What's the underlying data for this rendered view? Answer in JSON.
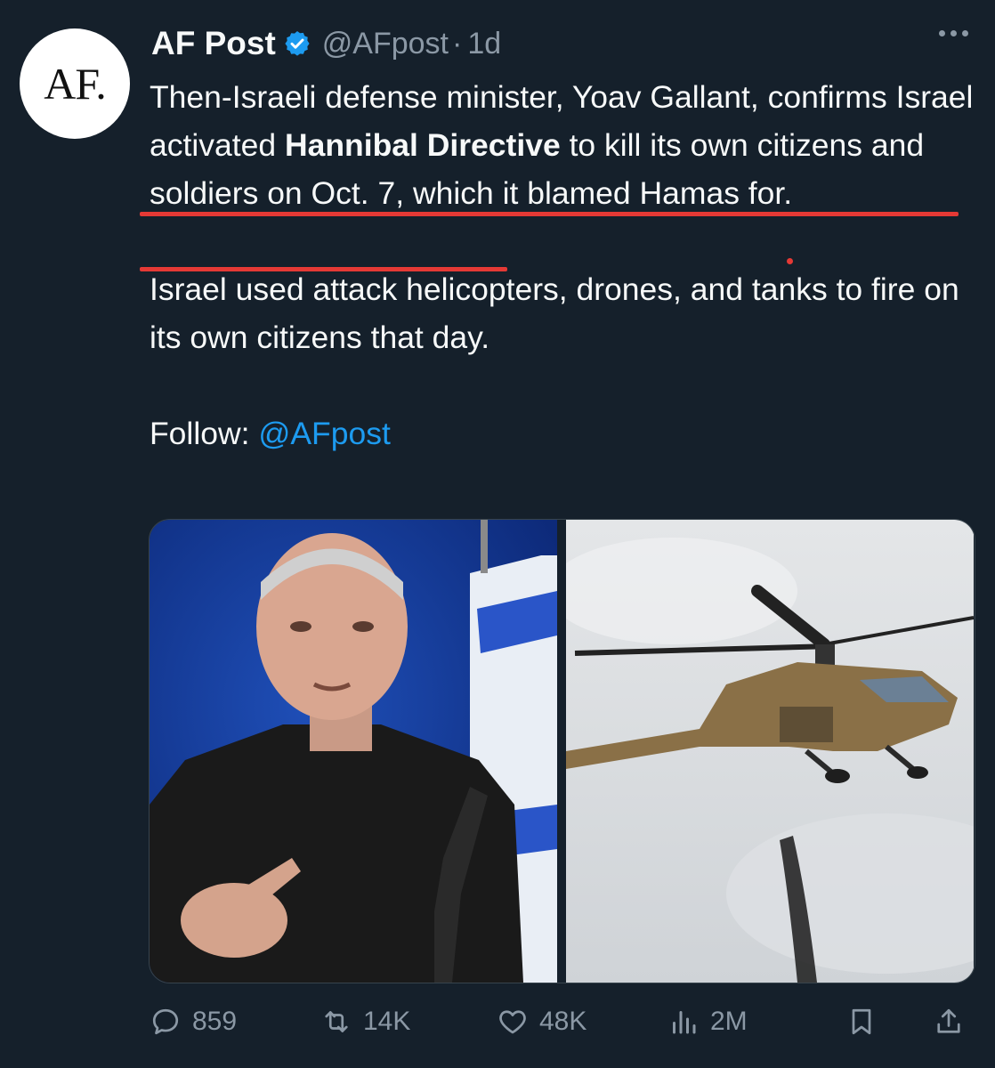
{
  "post": {
    "author_name": "AF Post",
    "avatar_text": "AF.",
    "handle": "@AFpost",
    "separator": "·",
    "time": "1d",
    "paragraph1": {
      "part1": "Then-Israeli defense minister, Yoav Gallant, confirms Israel activated ",
      "bold": "Hannibal Directive",
      "part2": " to kill its own citizens and soldiers on Oct. 7, which it blamed Hamas for."
    },
    "paragraph2": "Israel used attack helicopters, drones, and tanks to fire on its own citizens that day.",
    "paragraph3": {
      "prefix": "Follow: ",
      "mention": "@AFpost"
    }
  },
  "actions": {
    "replies": "859",
    "reposts": "14K",
    "likes": "48K",
    "views": "2M"
  },
  "icons": {
    "more": "more-dots-icon",
    "verified": "verified-badge-icon",
    "reply": "reply-icon",
    "repost": "repost-icon",
    "like": "heart-icon",
    "views": "views-chart-icon",
    "bookmark": "bookmark-icon",
    "share": "share-icon"
  },
  "colors": {
    "background": "#15202b",
    "text": "#f7f9f9",
    "secondary_text": "#8b98a5",
    "link": "#1d9bf0",
    "verified": "#1d9bf0",
    "annotation": "#e53935"
  }
}
